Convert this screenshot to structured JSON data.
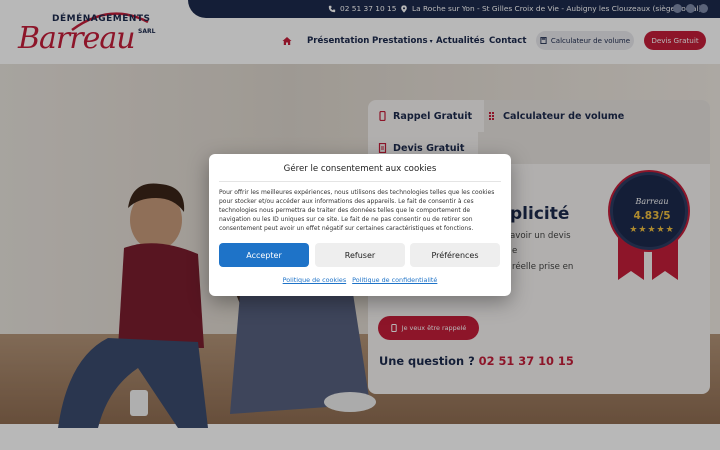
{
  "header": {
    "phone": "02 51 37 10 15",
    "address": "La Roche sur Yon - St Gilles Croix de Vie - Aubigny les Clouzeaux (siège social)",
    "social_icons": [
      "facebook-icon",
      "linkedin-icon",
      "instagram-icon"
    ]
  },
  "logo": {
    "top_text": "DÉMÉNAGEMENTS",
    "main_text": "Barreau",
    "sarl": "SARL"
  },
  "nav": {
    "items": [
      "Présentation",
      "Prestations",
      "Actualités",
      "Contact"
    ],
    "calc_button": "Calculateur de volume",
    "devis_button": "Devis Gratuit"
  },
  "panel": {
    "tabs": [
      "Rappel Gratuit",
      "Calculateur de volume",
      "Devis Gratuit"
    ],
    "headline": "plicité",
    "text1": "avoir un devis",
    "text2": "e",
    "text3": "réelle prise en",
    "recall_button": "Je veux être rappelé",
    "question_label": "Une question ?",
    "question_phone": "02 51 37 10 15"
  },
  "badge": {
    "brand": "Barreau",
    "rating": "4.83/5",
    "stars": "★★★★★"
  },
  "consent": {
    "title": "Gérer le consentement aux cookies",
    "body": "Pour offrir les meilleures expériences, nous utilisons des technologies telles que les cookies pour stocker et/ou accéder aux informations des appareils. Le fait de consentir à ces technologies nous permettra de traiter des données telles que le comportement de navigation ou les ID uniques sur ce site. Le fait de ne pas consentir ou de retirer son consentement peut avoir un effet négatif sur certaines caractéristiques et fonctions.",
    "accept": "Accepter",
    "refuse": "Refuser",
    "preferences": "Préférences",
    "cookie_policy": "Politique de cookies",
    "privacy_policy": "Politique de confidentialité"
  },
  "colors": {
    "brand_navy": "#1d2a4d",
    "brand_red": "#c41e3a",
    "accept_blue": "#1e73c8"
  }
}
